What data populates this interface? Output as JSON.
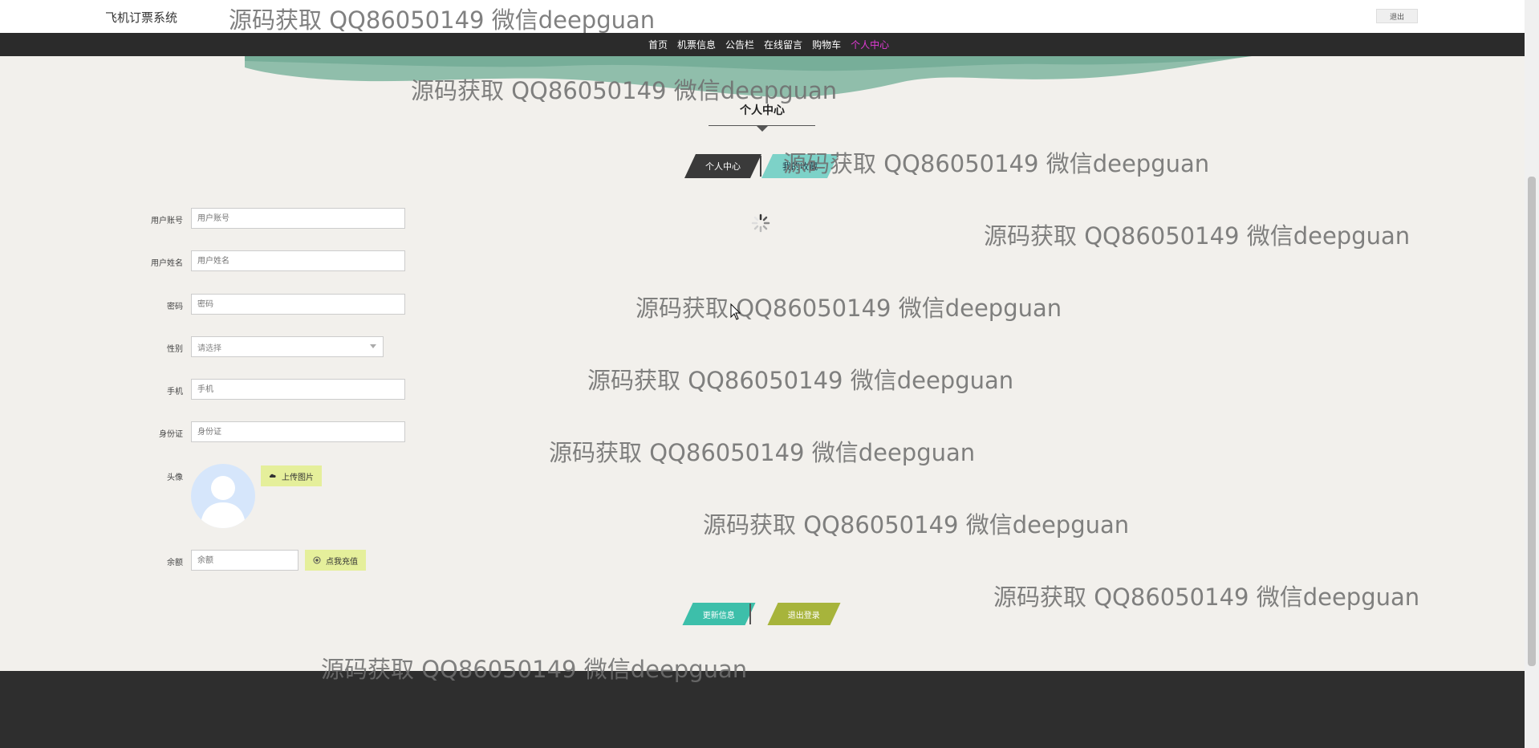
{
  "header": {
    "site_title": "飞机订票系统",
    "logout_label": "退出"
  },
  "nav": {
    "items": [
      "首页",
      "机票信息",
      "公告栏",
      "在线留言",
      "购物车",
      "个人中心"
    ],
    "active_index": 5
  },
  "section": {
    "title": "个人中心"
  },
  "tabs": [
    "个人中心",
    "我的收藏"
  ],
  "form": {
    "fields": [
      {
        "label": "用户账号",
        "placeholder": "用户账号"
      },
      {
        "label": "用户姓名",
        "placeholder": "用户姓名"
      },
      {
        "label": "密码",
        "placeholder": "密码"
      },
      {
        "label": "性别",
        "placeholder": "请选择"
      },
      {
        "label": "手机",
        "placeholder": "手机"
      },
      {
        "label": "身份证",
        "placeholder": "身份证"
      }
    ],
    "avatar_label": "头像",
    "upload_label": "上传图片",
    "balance_label": "余额",
    "balance_placeholder": "余额",
    "recharge_label": "点我充值"
  },
  "actions": {
    "update_label": "更新信息",
    "logout_label": "退出登录"
  },
  "watermark": "源码获取 QQ86050149 微信deepguan",
  "colors": {
    "nav_active": "#e23ad6",
    "wave": "#7fb5a0",
    "update_button": "#3dbfaa",
    "logout_button": "#a7b43b",
    "upload_button": "#e5ef9b"
  }
}
